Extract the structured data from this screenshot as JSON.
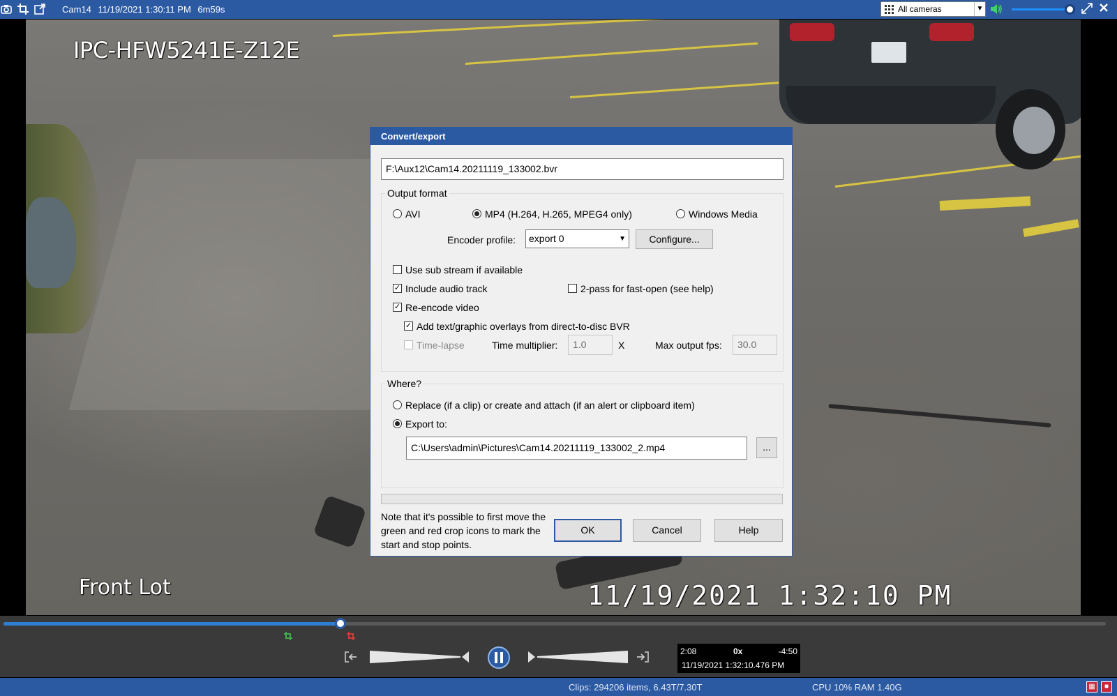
{
  "topbar": {
    "camera_name": "Cam14",
    "datetime": "11/19/2021 1:30:11 PM",
    "duration": "6m59s",
    "camera_select": "All cameras",
    "volume_level": 0.9,
    "icons": [
      "camera-icon",
      "crop-icon",
      "popout-icon",
      "grid-icon",
      "speaker-icon",
      "fullscreen-icon",
      "close-icon"
    ]
  },
  "video": {
    "camera_model": "IPC-HFW5241E-Z12E",
    "location": "Front Lot",
    "timestamp": "11/19/2021 1:32:10 PM"
  },
  "dialog": {
    "title": "Convert/export",
    "source_path": "F:\\Aux12\\Cam14.20211119_133002.bvr",
    "output_format": {
      "label": "Output format",
      "options": [
        "AVI",
        "MP4 (H.264, H.265, MPEG4 only)",
        "Windows Media"
      ],
      "selected": "MP4 (H.264, H.265, MPEG4 only)"
    },
    "encoder_profile_label": "Encoder profile:",
    "encoder_profile_value": "export 0",
    "configure_button": "Configure...",
    "options": {
      "sub_stream": {
        "label": "Use sub stream if available",
        "checked": false
      },
      "audio": {
        "label": "Include audio track",
        "checked": true
      },
      "two_pass": {
        "label": "2-pass for fast-open (see help)",
        "checked": false
      },
      "reencode": {
        "label": "Re-encode video",
        "checked": true
      },
      "overlays": {
        "label": "Add text/graphic overlays from direct-to-disc BVR",
        "checked": true
      },
      "timelapse": {
        "label": "Time-lapse",
        "checked": false
      }
    },
    "time_multiplier_label": "Time multiplier:",
    "time_multiplier_value": "1.0",
    "time_multiplier_unit": "X",
    "max_fps_label": "Max output fps:",
    "max_fps_value": "30.0",
    "where": {
      "label": "Where?",
      "replace_label": "Replace (if a clip) or create and attach (if an alert or clipboard item)",
      "export_label": "Export to:",
      "selected": "Export to:",
      "export_path": "C:\\Users\\admin\\Pictures\\Cam14.20211119_133002_2.mp4",
      "browse_button": "..."
    },
    "note": "Note that it's possible to first move the green and red crop icons to mark the start and stop points.",
    "ok_button": "OK",
    "cancel_button": "Cancel",
    "help_button": "Help"
  },
  "player": {
    "seek_progress": 0.306,
    "elapsed": "2:08",
    "speed": "0x",
    "remaining": "-4:50",
    "position_time": "11/19/2021 1:32:10.476 PM"
  },
  "statusbar": {
    "clips": "Clips: 294206 items, 6.43T/7.30T",
    "cpu_ram": "CPU 10% RAM 1.40G"
  },
  "colors": {
    "accent": "#2b5aa3",
    "seek_fill": "#2d7fd3",
    "crop_start": "#3fae4a",
    "crop_end": "#d23a3a"
  }
}
